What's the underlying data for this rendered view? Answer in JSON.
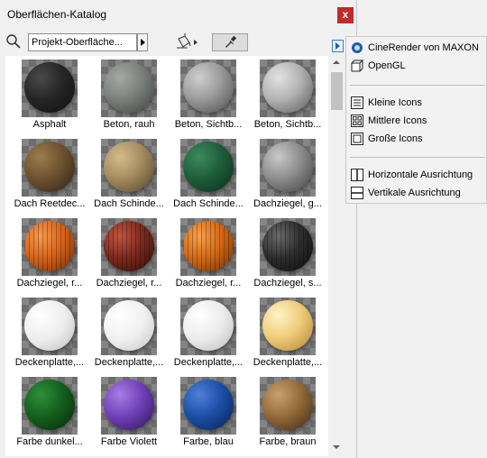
{
  "window": {
    "title": "Oberflächen-Katalog",
    "close_label": "x"
  },
  "toolbar": {
    "search_value": "Projekt-Oberfläche..."
  },
  "materials": [
    {
      "label": "Asphalt",
      "style": "radial-gradient(circle at 32% 30%, #4a4a4a 0%, #262626 45%, #0e0e0e 100%)"
    },
    {
      "label": "Beton, rauh",
      "style": "radial-gradient(circle at 32% 30%, #a6aaa7 0%, #7c807d 45%, #3d403e 100%)"
    },
    {
      "label": "Beton, Sichtb...",
      "style": "radial-gradient(circle at 32% 30%, #cfcfcf 0%, #9a9a9a 45%, #4b4b4b 100%)"
    },
    {
      "label": "Beton, Sichtb...",
      "style": "radial-gradient(circle at 32% 30%, #e2e2e2 0%, #b3b3b3 45%, #575757 100%)"
    },
    {
      "label": "Dach Reetdec...",
      "style": "radial-gradient(circle at 32% 30%, #9c7c4c 0%, #6e5230 45%, #2d2010 100%)"
    },
    {
      "label": "Dach Schinde...",
      "style": "radial-gradient(circle at 32% 30%, #d3bd8c 0%, #a58c5f 45%, #4f4128 100%)"
    },
    {
      "label": "Dach Schinde...",
      "style": "radial-gradient(circle at 32% 30%, #3d8a5c 0%, #1e5e3a 45%, #0b2a19 100%)"
    },
    {
      "label": "Dachziegel, g...",
      "style": "radial-gradient(circle at 32% 30%, #c9c9c9 0%, #8d8d8d 45%, #3e3e3e 100%)"
    },
    {
      "label": "Dachziegel, r...",
      "style": "radial-gradient(circle at 32% 30%, #f59b4e 0%, #d8641a 45%, #6e2a05 100%)",
      "ribbed": true
    },
    {
      "label": "Dachziegel, r...",
      "style": "radial-gradient(circle at 32% 30%, #c25544 0%, #7e2a1e 45%, #2d0d08 100%)",
      "ribbed": true
    },
    {
      "label": "Dachziegel, r...",
      "style": "radial-gradient(circle at 32% 30%, #f7a04a 0%, #d56a15 45%, #6b2e04 100%)",
      "ribbed": true
    },
    {
      "label": "Dachziegel, s...",
      "style": "radial-gradient(circle at 32% 30%, #6a6a6a 0%, #2e2e2e 45%, #0a0a0a 100%)",
      "ribbed": true
    },
    {
      "label": "Deckenplatte,...",
      "style": "radial-gradient(circle at 32% 30%, #ffffff 0%, #ededed 50%, #bdbdbd 100%)"
    },
    {
      "label": "Deckenplatte,...",
      "style": "radial-gradient(circle at 32% 30%, #ffffff 0%, #f0f0f0 50%, #c4c4c4 100%)"
    },
    {
      "label": "Deckenplatte,...",
      "style": "radial-gradient(circle at 32% 30%, #ffffff 0%, #ebebeb 50%, #b8b8b8 100%)"
    },
    {
      "label": "Deckenplatte,...",
      "style": "radial-gradient(circle at 32% 30%, #fff3c8 0%, #f0cd7a 45%, #b08132 100%)"
    },
    {
      "label": "Farbe dunkel...",
      "style": "radial-gradient(circle at 32% 30%, #2f8f3c 0%, #14601e 45%, #052708 100%)"
    },
    {
      "label": "Farbe Violett",
      "style": "radial-gradient(circle at 32% 30%, #a77ce6 0%, #7141b8 45%, #2b1454 100%)"
    },
    {
      "label": "Farbe, blau",
      "style": "radial-gradient(circle at 32% 30%, #4f80d6 0%, #1c4fa8 45%, #081f4d 100%)"
    },
    {
      "label": "Farbe, braun",
      "style": "radial-gradient(circle at 32% 30%, #c8a070 0%, #946a3a 45%, #3d2912 100%)"
    }
  ],
  "menu": {
    "items": [
      {
        "label": "CineRender von MAXON",
        "icon": "cinerender-icon"
      },
      {
        "label": "OpenGL",
        "icon": "opengl-icon"
      },
      {
        "label": "Kleine Icons",
        "icon": "small-icons-icon"
      },
      {
        "label": "Mittlere Icons",
        "icon": "medium-icons-icon"
      },
      {
        "label": "Große Icons",
        "icon": "large-icons-icon"
      },
      {
        "label": "Horizontale Ausrichtung",
        "icon": "horizontal-layout-icon"
      },
      {
        "label": "Vertikale Ausrichtung",
        "icon": "vertical-layout-icon"
      }
    ]
  },
  "colors": {
    "close_red": "#c22b2b",
    "accent_blue": "#1d5fa8"
  }
}
